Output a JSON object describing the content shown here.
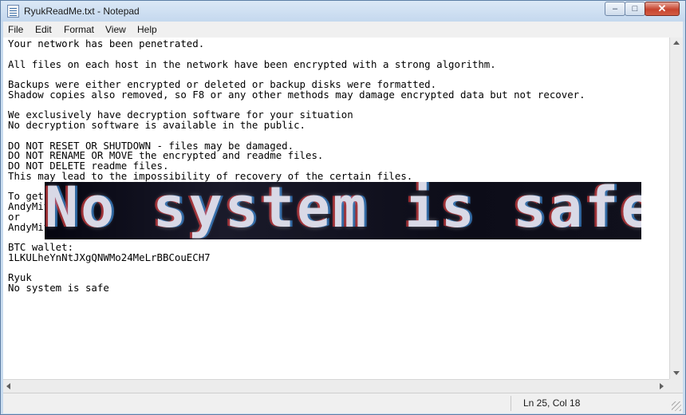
{
  "window": {
    "title": "RyukReadMe.txt - Notepad",
    "buttons": {
      "minimize": "–",
      "maximize": "□",
      "close": "✕"
    }
  },
  "menu": [
    "File",
    "Edit",
    "Format",
    "View",
    "Help"
  ],
  "document": {
    "text": "Your network has been penetrated.\n\nAll files on each host in the network have been encrypted with a strong algorithm.\n\nBackups were either encrypted or deleted or backup disks were formatted.\nShadow copies also removed, so F8 or any other methods may damage encrypted data but not recover.\n\nWe exclusively have decryption software for your situation\nNo decryption software is available in the public.\n\nDO NOT RESET OR SHUTDOWN - files may be damaged.\nDO NOT RENAME OR MOVE the encrypted and readme files.\nDO NOT DELETE readme files.\nThis may lead to the impossibility of recovery of the certain files.\n\nTo get info (decrypt your files) contact us at\nAndyMitton@protonmail.com\nor\nAndyMitton@tutanota.com\n\nBTC wallet:\n1LKULheYnNtJXgQNWMo24MeLrBBCouECH7\n\nRyuk\nNo system is safe"
  },
  "overlay": {
    "text": "No system is safe"
  },
  "status": {
    "position": "Ln 25, Col 18"
  }
}
